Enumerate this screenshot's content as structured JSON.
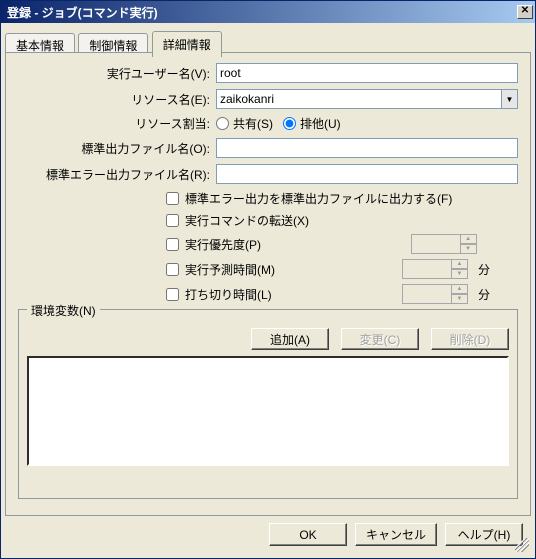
{
  "window": {
    "title": "登録 - ジョブ(コマンド実行)"
  },
  "tabs": {
    "t1": "基本情報",
    "t2": "制御情報",
    "t3": "詳細情報"
  },
  "labels": {
    "exec_user": "実行ユーザー名(V):",
    "resource_name": "リソース名(E):",
    "resource_alloc": "リソース割当:",
    "stdout_file": "標準出力ファイル名(O):",
    "stderr_file": "標準エラー出力ファイル名(R):"
  },
  "values": {
    "exec_user": "root",
    "resource_name": "zaikokanri",
    "stdout_file": "",
    "stderr_file": ""
  },
  "radios": {
    "shared": "共有(S)",
    "exclusive": "排他(U)"
  },
  "checks": {
    "stderr_to_stdout": "標準エラー出力を標準出力ファイルに出力する(F)",
    "cmd_transfer": "実行コマンドの転送(X)",
    "exec_priority": "実行優先度(P)",
    "exec_est_time": "実行予測時間(M)",
    "cutoff_time": "打ち切り時間(L)"
  },
  "units": {
    "minutes": "分"
  },
  "group": {
    "legend": "環境変数(N)",
    "add": "追加(A)",
    "change": "変更(C)",
    "delete": "削除(D)"
  },
  "footer": {
    "ok": "OK",
    "cancel": "キャンセル",
    "help": "ヘルプ(H)"
  }
}
